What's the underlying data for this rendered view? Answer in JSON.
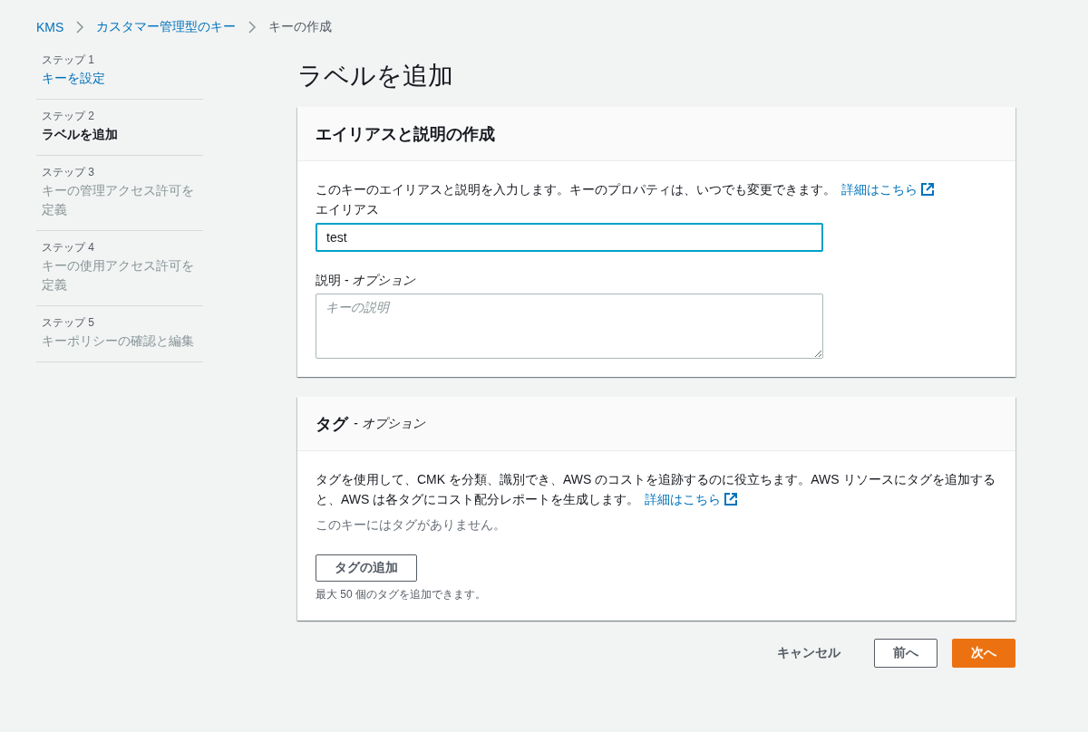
{
  "breadcrumb": [
    {
      "label": "KMS",
      "kind": "link"
    },
    {
      "label": "カスタマー管理型のキー",
      "kind": "link"
    },
    {
      "label": "キーの作成",
      "kind": "current"
    }
  ],
  "steps": [
    {
      "step": "ステップ 1",
      "label": "キーを設定",
      "selected": false,
      "disabled": false
    },
    {
      "step": "ステップ 2",
      "label": "ラベルを追加",
      "selected": true,
      "disabled": false
    },
    {
      "step": "ステップ 3",
      "label": "キーの管理アクセス許可を定義",
      "selected": false,
      "disabled": true
    },
    {
      "step": "ステップ 4",
      "label": "キーの使用アクセス許可を定義",
      "selected": false,
      "disabled": true
    },
    {
      "step": "ステップ 5",
      "label": "キーポリシーの確認と編集",
      "selected": false,
      "disabled": true
    }
  ],
  "page_title": "ラベルを追加",
  "alias_panel": {
    "title": "エイリアスと説明の作成",
    "description": "このキーのエイリアスと説明を入力します。キーのプロパティは、いつでも変更できます。",
    "link": "詳細はこちら",
    "alias_label": "エイリアス",
    "alias_value": "test",
    "desc_label": "説明",
    "desc_separator": "-",
    "desc_optional": "オプション",
    "desc_placeholder": "キーの説明"
  },
  "tags_panel": {
    "title": "タグ",
    "separator": "-",
    "optional": "オプション",
    "description": "タグを使用して、CMK を分類、識別でき、AWS のコストを追跡するのに役立ちます。AWS リソースにタグを追加すると、AWS は各タグにコスト配分レポートを生成します。",
    "link": "詳細はこちら",
    "empty": "このキーにはタグがありません。",
    "add_button": "タグの追加",
    "limit": "最大 50 個のタグを追加できます。"
  },
  "actions": [
    {
      "label": "キャンセル",
      "kind": "text"
    },
    {
      "label": "前へ",
      "kind": "outline"
    },
    {
      "label": "次へ",
      "kind": "primary"
    }
  ]
}
